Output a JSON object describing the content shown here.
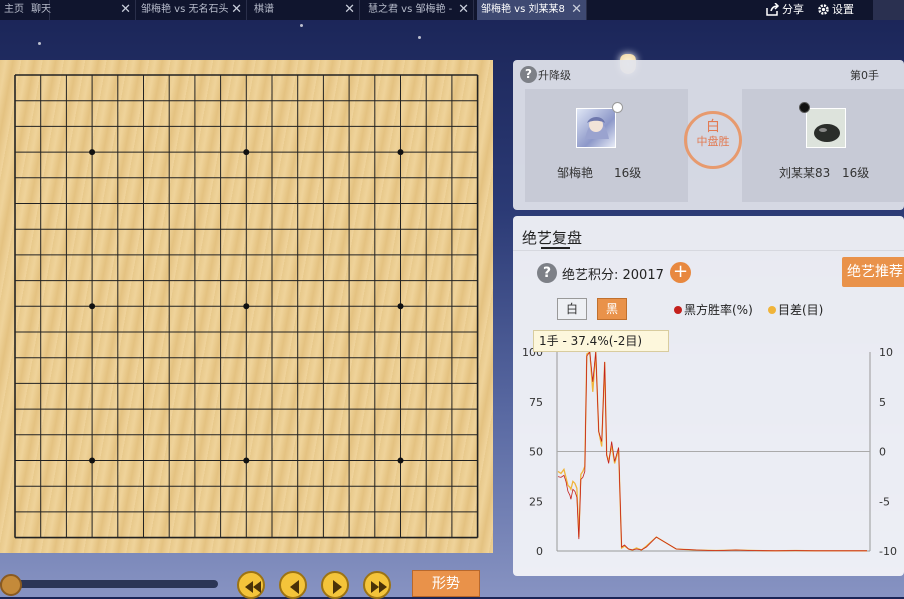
{
  "tabs": [
    {
      "label": "主页",
      "closable": false
    },
    {
      "label": "聊天",
      "closable": true
    },
    {
      "label": "邹梅艳 vs 无名石头",
      "closable": true
    },
    {
      "label": "棋谱",
      "closable": true
    },
    {
      "label": "慧之君 vs 邹梅艳 -",
      "closable": true
    },
    {
      "label": "邹梅艳 vs 刘某某8",
      "closable": true,
      "active": true
    }
  ],
  "toolbar": {
    "share_label": "分享",
    "settings_label": "设置"
  },
  "game_info": {
    "level_label": "升降级",
    "move_count": "第0手",
    "white_player": {
      "name": "邹梅艳",
      "rank": "16级"
    },
    "black_player": {
      "name": "刘某某83",
      "rank": "16级"
    },
    "result_winner": "白",
    "result_type": "中盘胜"
  },
  "review": {
    "title": "绝艺复盘",
    "score_label": "绝艺积分: 20017",
    "recommend_label": "绝艺推荐",
    "white_btn": "白",
    "black_btn": "黑",
    "legend_winrate": "黑方胜率(%)",
    "legend_diff": "目差(目)",
    "tooltip": "1手 - 37.4%(-2目)"
  },
  "controls": {
    "trend_label": "形势"
  },
  "colors": {
    "winrate_line": "#c4201c",
    "diff_line": "#f0b43a",
    "accent": "#e9924a"
  },
  "chart_data": {
    "type": "line",
    "left_axis": {
      "ticks": [
        "100",
        "75",
        "50",
        "25",
        "0"
      ],
      "ylim": [
        0,
        100
      ]
    },
    "right_axis": {
      "ticks": [
        "10",
        "5",
        "0",
        "-5",
        "-10"
      ],
      "ylim": [
        -10,
        10
      ]
    },
    "series": [
      {
        "name": "黑方胜率(%)",
        "x": [
          1,
          4,
          7,
          9,
          11,
          13,
          14,
          16,
          18,
          20,
          22,
          24,
          26,
          28,
          30,
          33,
          36,
          39,
          42,
          45,
          48,
          50,
          52,
          55,
          58,
          62,
          65,
          68,
          72,
          76,
          80,
          85,
          90,
          100,
          120,
          140,
          160,
          180,
          200,
          220,
          240,
          260,
          280,
          300,
          312
        ],
        "y": [
          37.4,
          37,
          38,
          35,
          30,
          28,
          26,
          31,
          30,
          27,
          6,
          36,
          37,
          40,
          98,
          100,
          85,
          100,
          60,
          55,
          95,
          48,
          44,
          55,
          45,
          52,
          2,
          3,
          1,
          0.5,
          1,
          0.5,
          2,
          7,
          1,
          0.5,
          0.2,
          0.5,
          0.2,
          0.1,
          0.2,
          0.1,
          0.1,
          0.1,
          0.1
        ]
      },
      {
        "name": "目差(目)",
        "x": [
          1,
          4,
          7,
          9,
          11,
          13,
          14,
          16,
          18,
          20,
          22,
          24,
          26,
          28,
          30,
          33,
          36,
          39,
          42,
          45,
          48,
          50,
          52,
          55,
          58,
          62,
          65,
          68,
          72,
          76,
          80,
          85,
          90,
          100,
          120,
          140,
          160,
          180,
          200,
          220,
          240,
          260,
          280,
          300,
          312
        ],
        "y": [
          -2,
          -2.2,
          -1.8,
          -2.6,
          -3.4,
          -3.6,
          -3.8,
          -3,
          -3.2,
          -3.7,
          -8.6,
          -2.3,
          -2,
          -1.5,
          9.8,
          10,
          6,
          10,
          2,
          0.5,
          9,
          -0.3,
          -1,
          0.6,
          -1.2,
          0.2,
          -9.7,
          -9.5,
          -9.8,
          -9.9,
          -9.7,
          -9.9,
          -9.5,
          -8.6,
          -9.8,
          -9.9,
          -9.95,
          -9.9,
          -9.95,
          -9.98,
          -9.95,
          -9.98,
          -9.98,
          -9.98,
          -9.98
        ]
      }
    ],
    "xlim": [
      0,
      315
    ]
  }
}
